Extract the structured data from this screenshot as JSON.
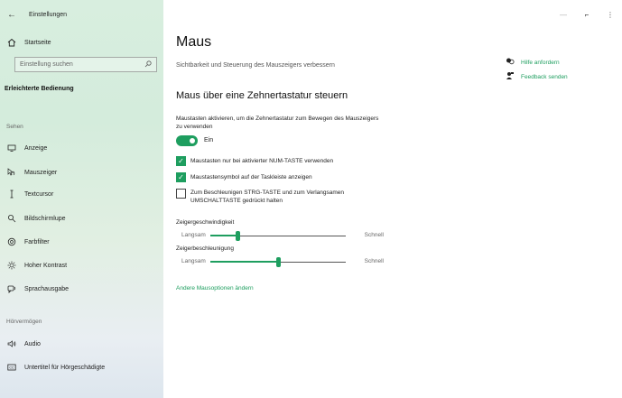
{
  "app": {
    "title": "Einstellungen",
    "back_icon": "arrow-left-icon"
  },
  "window": {
    "minimize": "—",
    "maximize": "⌐",
    "close": "⋮"
  },
  "sidebar": {
    "home_label": "Startseite",
    "search_placeholder": "Einstellung suchen",
    "category": "Erleichterte Bedienung",
    "section_sehen": "Sehen",
    "items_sehen": [
      {
        "label": "Anzeige",
        "icon": "monitor-icon"
      },
      {
        "label": "Mauszeiger",
        "icon": "mouse-pointer-icon"
      },
      {
        "label": "Textcursor",
        "icon": "text-cursor-icon"
      },
      {
        "label": "Bildschirmlupe",
        "icon": "magnifier-icon"
      },
      {
        "label": "Farbfilter",
        "icon": "color-filter-icon"
      },
      {
        "label": "Hoher Kontrast",
        "icon": "high-contrast-icon"
      },
      {
        "label": "Sprachausgabe",
        "icon": "narrator-icon"
      }
    ],
    "section_hoeren": "Hörvermögen",
    "items_hoeren": [
      {
        "label": "Audio",
        "icon": "audio-icon"
      },
      {
        "label": "Untertitel für Hörgeschädigte",
        "icon": "closed-captions-icon"
      }
    ]
  },
  "main": {
    "title": "Maus",
    "subtitle": "Sichtbarkeit und Steuerung des Mauszeigers verbessern",
    "section_title": "Maus über eine Zehnertastatur steuern",
    "toggle_description": "Maustasten aktivieren, um die Zehnertastatur zum Bewegen des Mauszeigers zu verwenden",
    "toggle_state": "Ein",
    "toggle_on": true,
    "checkboxes": [
      {
        "label": "Maustasten nur bei aktivierter NUM-TASTE verwenden",
        "checked": true
      },
      {
        "label": "Maustastensymbol auf der Taskleiste anzeigen",
        "checked": true
      },
      {
        "label": "Zum Beschleunigen STRG-TASTE und zum Verlangsamen UMSCHALTTASTE gedrückt halten",
        "checked": false
      }
    ],
    "sliders": [
      {
        "title": "Zeigergeschwindigkeit",
        "min_label": "Langsam",
        "max_label": "Schnell",
        "value_fraction": 0.2
      },
      {
        "title": "Zeigerbeschleunigung",
        "min_label": "Langsam",
        "max_label": "Schnell",
        "value_fraction": 0.5
      }
    ],
    "more_link": "Andere Mausoptionen ändern"
  },
  "help": {
    "items": [
      {
        "label": "Hilfe anfordern",
        "icon": "help-chat-icon"
      },
      {
        "label": "Feedback senden",
        "icon": "feedback-icon"
      }
    ]
  },
  "colors": {
    "accent": "#1e9e5f"
  }
}
